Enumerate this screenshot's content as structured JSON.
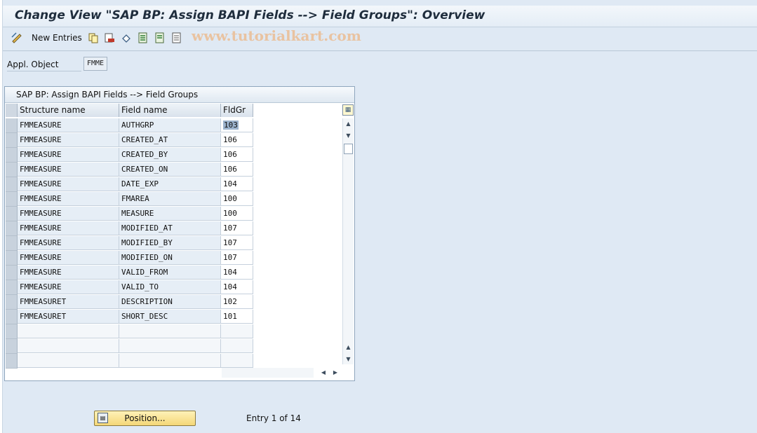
{
  "window": {
    "title": "Change View \"SAP BP: Assign BAPI Fields --> Field Groups\": Overview"
  },
  "toolbar": {
    "new_entries_label": "New Entries",
    "icons": [
      "change-display-icon",
      "copy-icon",
      "delete-icon",
      "undo-icon",
      "select-all-icon",
      "select-block-icon",
      "deselect-all-icon"
    ]
  },
  "watermark": "www.tutorialkart.com",
  "appl_object": {
    "label": "Appl. Object",
    "value": "FMME"
  },
  "table": {
    "title": "SAP BP: Assign BAPI Fields --> Field Groups",
    "columns": [
      "Structure name",
      "Field name",
      "FldGr"
    ],
    "rows": [
      {
        "structure": "FMMEASURE",
        "field": "AUTHGRP",
        "fldgr": "103"
      },
      {
        "structure": "FMMEASURE",
        "field": "CREATED_AT",
        "fldgr": "106"
      },
      {
        "structure": "FMMEASURE",
        "field": "CREATED_BY",
        "fldgr": "106"
      },
      {
        "structure": "FMMEASURE",
        "field": "CREATED_ON",
        "fldgr": "106"
      },
      {
        "structure": "FMMEASURE",
        "field": "DATE_EXP",
        "fldgr": "104"
      },
      {
        "structure": "FMMEASURE",
        "field": "FMAREA",
        "fldgr": "100"
      },
      {
        "structure": "FMMEASURE",
        "field": "MEASURE",
        "fldgr": "100"
      },
      {
        "structure": "FMMEASURE",
        "field": "MODIFIED_AT",
        "fldgr": "107"
      },
      {
        "structure": "FMMEASURE",
        "field": "MODIFIED_BY",
        "fldgr": "107"
      },
      {
        "structure": "FMMEASURE",
        "field": "MODIFIED_ON",
        "fldgr": "107"
      },
      {
        "structure": "FMMEASURE",
        "field": "VALID_FROM",
        "fldgr": "104"
      },
      {
        "structure": "FMMEASURE",
        "field": "VALID_TO",
        "fldgr": "104"
      },
      {
        "structure": "FMMEASURET",
        "field": "DESCRIPTION",
        "fldgr": "102"
      },
      {
        "structure": "FMMEASURET",
        "field": "SHORT_DESC",
        "fldgr": "101"
      }
    ],
    "empty_rows": 3
  },
  "footer": {
    "position_label": "Position...",
    "entry_info": "Entry 1 of 14"
  }
}
